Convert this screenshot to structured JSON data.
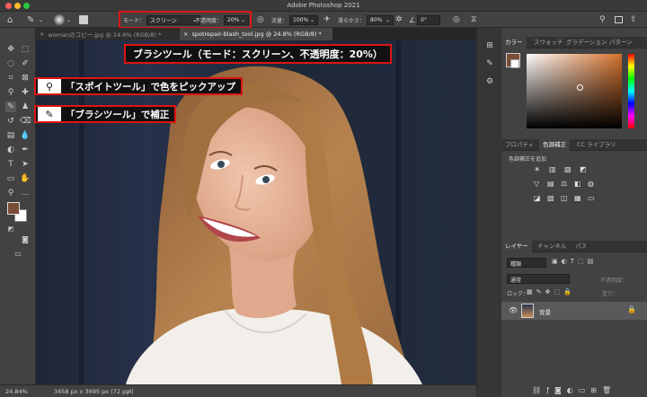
{
  "window": {
    "title": "Adobe Photoshop 2021"
  },
  "options_bar": {
    "mode_label": "モード：",
    "mode_value": "スクリーン",
    "opacity_label": "不透明度：",
    "opacity_value": "20%",
    "flow_label": "流量：",
    "flow_value": "100%",
    "smoothing_label": "滑らかさ：",
    "smoothing_value": "80%",
    "angle_value": "0°"
  },
  "tabs": [
    {
      "label": "womanのコピー.jpg @ 24.6% (RGB/8) *"
    },
    {
      "label": "spotrepair-blash_tool.jpg @ 24.8% (RGB/8) *"
    }
  ],
  "status_bar": {
    "zoom": "24.84%",
    "doc_info": "3458 px x 3695 px (72 ppi)"
  },
  "color_panel": {
    "tabs": [
      "カラー",
      "スウォッチ",
      "グラデーション",
      "パターン"
    ],
    "hue_color": "#d4702a",
    "foreground_color": "#7a4d38"
  },
  "adjustments_panel": {
    "tabs": [
      "プロパティ",
      "色調補正",
      "CC ライブラリ"
    ],
    "add_label": "色調補正を追加"
  },
  "layers_panel": {
    "tabs": [
      "レイヤー",
      "チャンネル",
      "パス"
    ],
    "filter_label": "種類",
    "blend_mode": "通常",
    "opacity_label": "不透明度：",
    "lock_label": "ロック：",
    "fill_label": "塗り：",
    "layer_name": "背景"
  },
  "annotations": {
    "brush_settings": "ブラシツール（モード：スクリーン、不透明度：20%）",
    "eyedropper": "「スポイトツール」で色をピックアップ",
    "brush_fix": "「ブラシツール」で補正"
  },
  "accent": {
    "callout_border": "#e01414"
  }
}
